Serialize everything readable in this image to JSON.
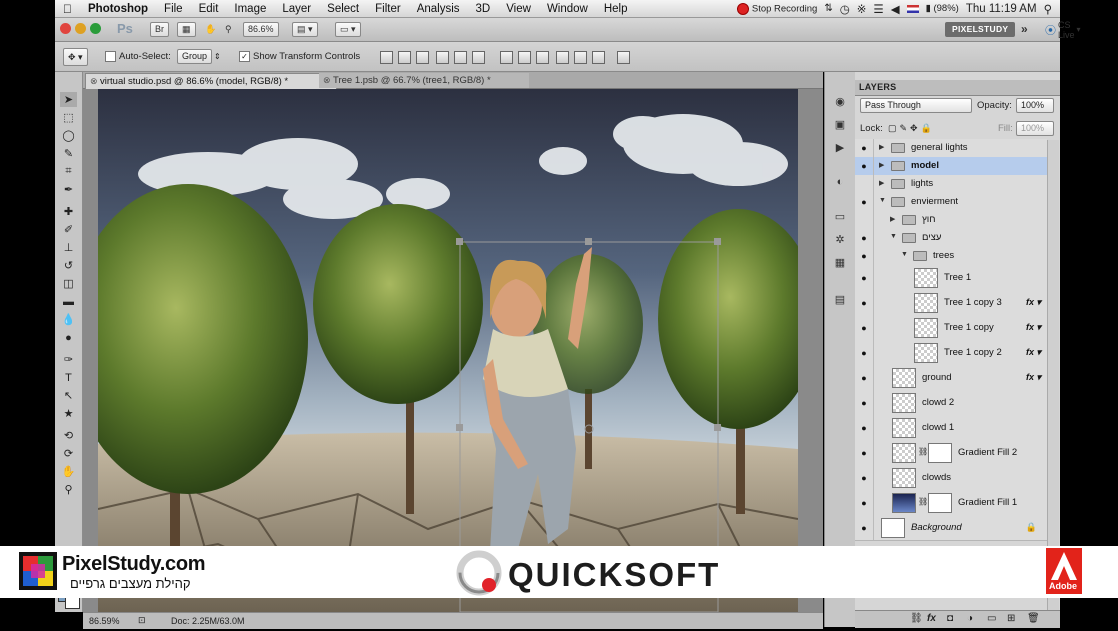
{
  "menubar": {
    "apple": "",
    "app": "Photoshop",
    "items": [
      "File",
      "Edit",
      "Image",
      "Layer",
      "Select",
      "Filter",
      "Analysis",
      "3D",
      "View",
      "Window",
      "Help"
    ],
    "recording": "Stop Recording",
    "battery": "(98%)",
    "clock": "Thu 11:19 AM"
  },
  "appbar": {
    "ps": "Ps",
    "zoom": "86.6%",
    "pixelstudy_btn": "PIXELSTUDY",
    "more": "»",
    "cslive": "CS Live"
  },
  "options": {
    "auto_select_label": "Auto-Select:",
    "auto_select_value": "Group",
    "show_transform_label": "Show Transform Controls"
  },
  "tabs": [
    {
      "label": "virtual studio.psd @ 86.6% (model, RGB/8) *"
    },
    {
      "label": "Tree 1.psb @ 66.7% (tree1, RGB/8) *"
    }
  ],
  "status": {
    "zoom": "86.59%",
    "doc": "Doc: 2.25M/63.0M"
  },
  "layers_panel": {
    "title": "LAYERS",
    "blend_mode": "Pass Through",
    "opacity_label": "Opacity:",
    "opacity_value": "100%",
    "lock_label": "Lock:",
    "fill_label": "Fill:",
    "fill_value": "100%",
    "rows": [
      {
        "name": "general lights",
        "kind": "group",
        "indent": 0,
        "open": false,
        "eye": true
      },
      {
        "name": "model",
        "kind": "group",
        "indent": 0,
        "open": false,
        "eye": true,
        "selected": true
      },
      {
        "name": "lights",
        "kind": "group",
        "indent": 0,
        "open": false,
        "eye": false
      },
      {
        "name": "envierment",
        "kind": "group",
        "indent": 0,
        "open": true,
        "eye": true
      },
      {
        "name": "חוץ",
        "kind": "group",
        "indent": 1,
        "open": false,
        "eye": false
      },
      {
        "name": "עצים",
        "kind": "group",
        "indent": 1,
        "open": true,
        "eye": true
      },
      {
        "name": "trees",
        "kind": "group",
        "indent": 2,
        "open": true,
        "eye": true
      },
      {
        "name": "Tree 1",
        "kind": "smart",
        "indent": 3,
        "eye": true,
        "fx": false
      },
      {
        "name": "Tree 1 copy 3",
        "kind": "smart",
        "indent": 3,
        "eye": true,
        "fx": true
      },
      {
        "name": "Tree 1 copy",
        "kind": "smart",
        "indent": 3,
        "eye": true,
        "fx": true
      },
      {
        "name": "Tree 1 copy 2",
        "kind": "smart",
        "indent": 3,
        "eye": true,
        "fx": true
      },
      {
        "name": "ground",
        "kind": "smart",
        "indent": 1,
        "eye": true,
        "fx": true
      },
      {
        "name": "clowd 2",
        "kind": "smart",
        "indent": 1,
        "eye": true,
        "fx": false
      },
      {
        "name": "clowd 1",
        "kind": "smart",
        "indent": 1,
        "eye": true,
        "fx": false
      },
      {
        "name": "Gradient Fill 2",
        "kind": "fill",
        "indent": 1,
        "eye": true,
        "fx": false
      },
      {
        "name": "clowds",
        "kind": "smart",
        "indent": 1,
        "eye": true,
        "fx": false
      },
      {
        "name": "Gradient Fill 1",
        "kind": "fill",
        "indent": 1,
        "eye": true,
        "fx": false
      },
      {
        "name": "Background",
        "kind": "bg",
        "indent": 0,
        "eye": true,
        "fx": false
      }
    ],
    "fx_label": "fx"
  },
  "banner": {
    "site": "PixelStudy.com",
    "tagline": "קהילת מעצבים גרפיים",
    "brand": "QUICKSOFT",
    "adobe": "Adobe"
  },
  "colors": {
    "selected_layer": "#b6ccec",
    "record_red": "#d22222",
    "adobe_red": "#e2231a"
  }
}
